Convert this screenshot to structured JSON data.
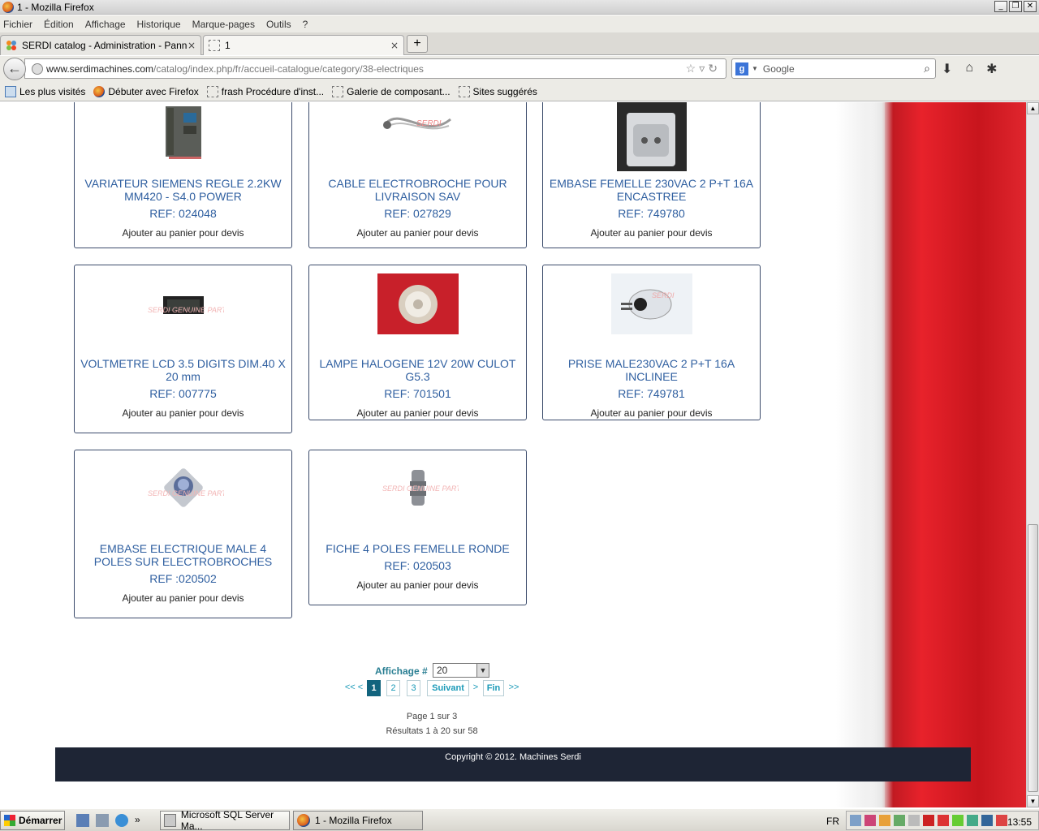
{
  "window": {
    "title": "1 - Mozilla Firefox"
  },
  "menu": [
    "Fichier",
    "Édition",
    "Affichage",
    "Historique",
    "Marque-pages",
    "Outils",
    "?"
  ],
  "tabs": [
    {
      "label": "SERDI catalog - Administration - Panneau...",
      "close": "×"
    },
    {
      "label": "1",
      "close": "×"
    }
  ],
  "newtab": "+",
  "url": {
    "host": "www.serdimachines.com",
    "path": "/catalog/index.php/fr/accueil-catalogue/category/38-electriques"
  },
  "search": {
    "placeholder": "Google"
  },
  "bookmarks": [
    "Les plus visités",
    "Débuter avec Firefox",
    "frash Procédure d'inst...",
    "Galerie de composant...",
    "Sites suggérés"
  ],
  "products": [
    {
      "name": "VARIATEUR SIEMENS REGLE 2.2KW MM420 - S4.0 POWER",
      "ref": "REF: 024048",
      "add": "Ajouter au panier pour devis"
    },
    {
      "name": "CABLE ELECTROBROCHE POUR LIVRAISON SAV",
      "ref": "REF: 027829",
      "add": "Ajouter au panier pour devis"
    },
    {
      "name": "EMBASE FEMELLE 230VAC 2 P+T 16A ENCASTREE",
      "ref": "REF: 749780",
      "add": "Ajouter au panier pour devis"
    },
    {
      "name": "VOLTMETRE LCD 3.5 DIGITS DIM.40 X 20 mm",
      "ref": "REF: 007775",
      "add": "Ajouter au panier pour devis"
    },
    {
      "name": "LAMPE HALOGENE 12V 20W CULOT G5.3",
      "ref": "REF: 701501",
      "add": "Ajouter au panier pour devis"
    },
    {
      "name": "PRISE MALE230VAC 2 P+T 16A INCLINEE",
      "ref": "REF: 749781",
      "add": "Ajouter au panier pour devis"
    },
    {
      "name": "EMBASE ELECTRIQUE MALE 4 POLES SUR ELECTROBROCHES",
      "ref": "REF :020502",
      "add": "Ajouter au panier pour devis"
    },
    {
      "name": "FICHE 4 POLES FEMELLE RONDE",
      "ref": "REF: 020503",
      "add": "Ajouter au panier pour devis"
    }
  ],
  "pagination": {
    "display_label": "Affichage #",
    "display_value": "20",
    "first": "<< <",
    "pages": [
      "1",
      "2",
      "3"
    ],
    "next": "Suivant",
    "sep": ">",
    "last": "Fin",
    "end": ">>",
    "page_info": "Page 1 sur 3",
    "results": "Résultats 1 à 20 sur 58"
  },
  "footer": {
    "copyright": "Copyright © 2012. Machines Serdi"
  },
  "taskbar": {
    "start": "Démarrer",
    "more": "»",
    "items": [
      "Microsoft SQL Server Ma...",
      "1 - Mozilla Firefox"
    ],
    "lang": "FR",
    "clock": "13:55"
  },
  "colors": {
    "link": "#2f5fa0",
    "accent_red": "#e8222b",
    "footer_bg": "#1e2535",
    "pager_active": "#12647e"
  }
}
